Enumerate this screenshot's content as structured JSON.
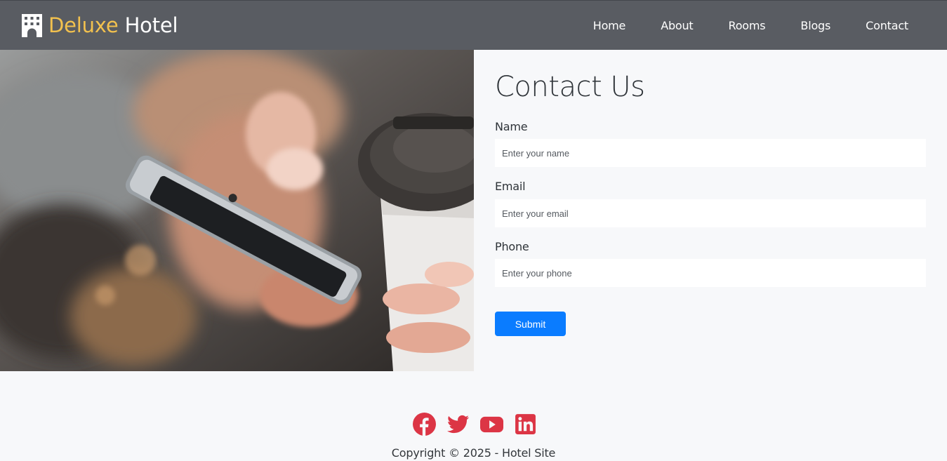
{
  "brand": {
    "name_part1": "Deluxe",
    "name_part2": "Hotel",
    "icon": "hotel-building-icon",
    "accent_color": "#f2c14e"
  },
  "nav": {
    "items": [
      {
        "label": "Home"
      },
      {
        "label": "About"
      },
      {
        "label": "Rooms"
      },
      {
        "label": "Blogs"
      },
      {
        "label": "Contact"
      }
    ]
  },
  "hero": {
    "image_alt": "hand holding smartphone and coffee cup"
  },
  "contact": {
    "title": "Contact Us",
    "fields": [
      {
        "label": "Name",
        "placeholder": "Enter your name",
        "value": ""
      },
      {
        "label": "Email",
        "placeholder": "Enter your email",
        "value": ""
      },
      {
        "label": "Phone",
        "placeholder": "Enter your phone",
        "value": ""
      }
    ],
    "submit_label": "Submit",
    "submit_color": "#0a7cff"
  },
  "footer": {
    "social": [
      {
        "icon": "facebook-icon"
      },
      {
        "icon": "twitter-icon"
      },
      {
        "icon": "youtube-icon"
      },
      {
        "icon": "linkedin-icon"
      }
    ],
    "icon_color": "#dc3545",
    "copyright": "Copyright © 2025 - Hotel Site"
  }
}
